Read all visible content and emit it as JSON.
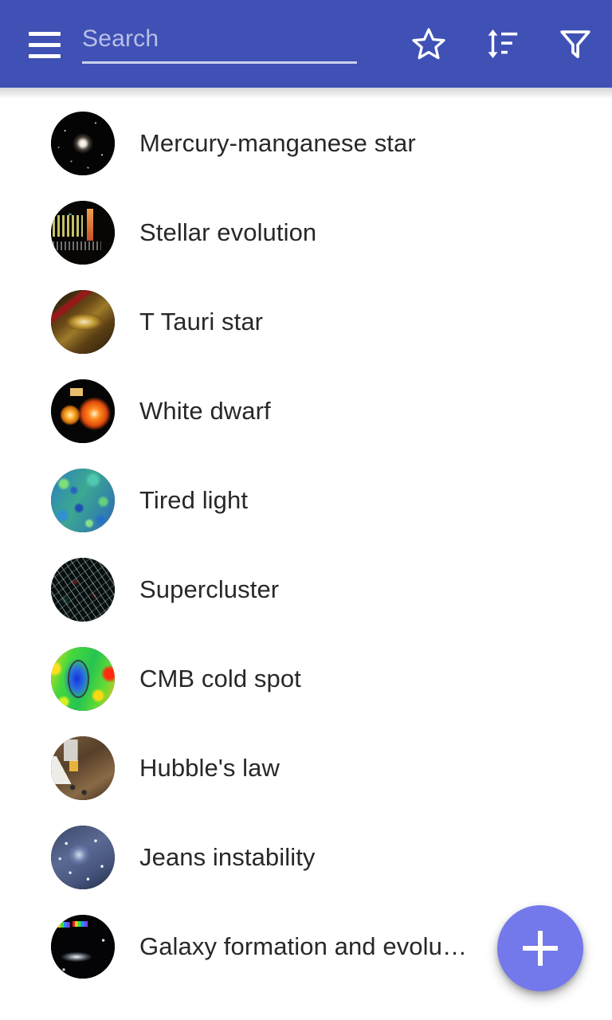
{
  "theme": {
    "toolbar_color": "#3f51b5",
    "fab_color": "#7379eb",
    "background_color": "#ffffff",
    "list_text_color": "#282828",
    "placeholder_color": "#b9bfe8"
  },
  "toolbar": {
    "menu_icon": "hamburger-menu-icon",
    "search": {
      "placeholder": "Search",
      "value": ""
    },
    "actions": [
      {
        "name": "favorites-button",
        "icon": "star-outline-icon",
        "label": "Favorites"
      },
      {
        "name": "sort-button",
        "icon": "sort-icon",
        "label": "Sort"
      },
      {
        "name": "filter-button",
        "icon": "filter-funnel-icon",
        "label": "Filter"
      }
    ]
  },
  "list": {
    "items": [
      {
        "label": "Mercury-manganese star",
        "thumb": "art-star-point",
        "thumb_name": "thumbnail-mercury-manganese-star"
      },
      {
        "label": "Stellar evolution",
        "thumb": "art-spectrum",
        "thumb_name": "thumbnail-stellar-evolution"
      },
      {
        "label": "T Tauri star",
        "thumb": "art-ttauri",
        "thumb_name": "thumbnail-t-tauri-star"
      },
      {
        "label": "White dwarf",
        "thumb": "art-whitedwarf",
        "thumb_name": "thumbnail-white-dwarf"
      },
      {
        "label": "Tired light",
        "thumb": "art-cmb-bluegreen",
        "thumb_name": "thumbnail-tired-light"
      },
      {
        "label": "Supercluster",
        "thumb": "art-filaments",
        "thumb_name": "thumbnail-supercluster"
      },
      {
        "label": "CMB cold spot",
        "thumb": "art-coldspot",
        "thumb_name": "thumbnail-cmb-cold-spot"
      },
      {
        "label": "Hubble's law",
        "thumb": "art-hubble",
        "thumb_name": "thumbnail-hubbles-law"
      },
      {
        "label": "Jeans instability",
        "thumb": "art-jeans",
        "thumb_name": "thumbnail-jeans-instability"
      },
      {
        "label": "Galaxy formation and evolu…",
        "thumb": "art-galaxyform",
        "thumb_name": "thumbnail-galaxy-formation-and-evolution"
      }
    ]
  },
  "fab": {
    "icon": "plus-icon",
    "label": "+"
  }
}
